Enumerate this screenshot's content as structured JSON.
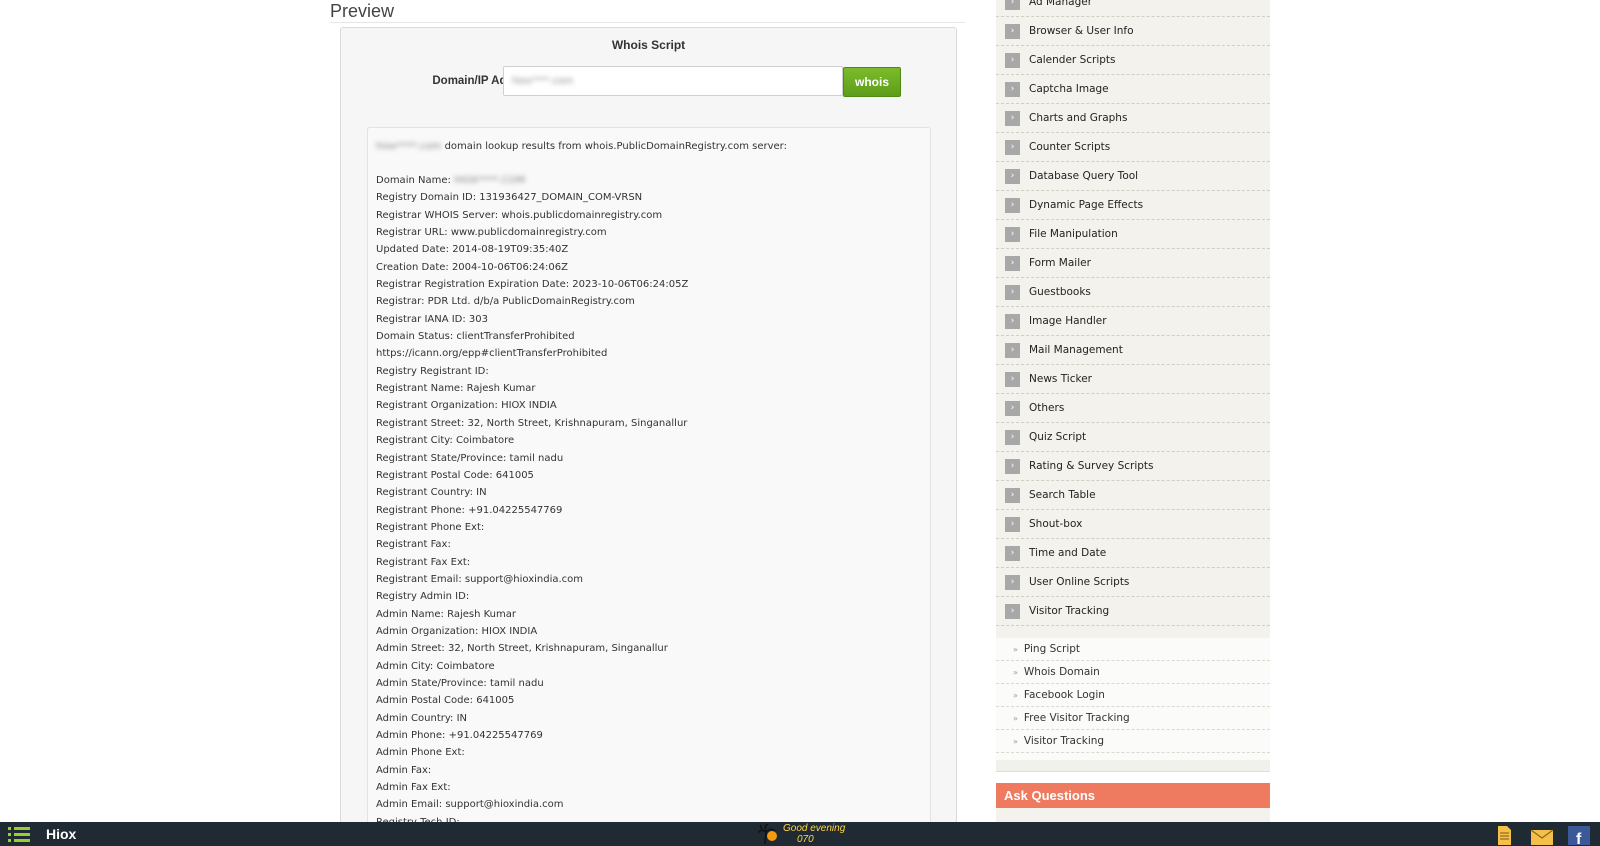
{
  "preview": {
    "title": "Preview"
  },
  "whois": {
    "title": "Whois Script",
    "domain_label": "Domain/IP Address:",
    "domain_value": "hiox****.com",
    "button_label": "whois",
    "results_intro_domain": "hiox****.com",
    "results_intro_rest": "domain lookup results from whois.PublicDomainRegistry.com server:",
    "domain_name_label": "Domain Name:",
    "domain_name_value": "HIOX****.COM",
    "lines": [
      "Registry Domain ID: 131936427_DOMAIN_COM-VRSN",
      "Registrar WHOIS Server: whois.publicdomainregistry.com",
      "Registrar URL: www.publicdomainregistry.com",
      "Updated Date: 2014-08-19T09:35:40Z",
      "Creation Date: 2004-10-06T06:24:06Z",
      "Registrar Registration Expiration Date: 2023-10-06T06:24:05Z",
      "Registrar: PDR Ltd. d/b/a PublicDomainRegistry.com",
      "Registrar IANA ID: 303",
      "Domain Status: clientTransferProhibited",
      "https://icann.org/epp#clientTransferProhibited",
      "Registry Registrant ID:",
      "Registrant Name: Rajesh Kumar",
      "Registrant Organization: HIOX INDIA",
      "Registrant Street: 32, North Street, Krishnapuram, Singanallur",
      "Registrant City: Coimbatore",
      "Registrant State/Province: tamil nadu",
      "Registrant Postal Code: 641005",
      "Registrant Country: IN",
      "Registrant Phone: +91.04225547769",
      "Registrant Phone Ext:",
      "Registrant Fax:",
      "Registrant Fax Ext:",
      "Registrant Email: support@hioxindia.com",
      "Registry Admin ID:",
      "Admin Name: Rajesh Kumar",
      "Admin Organization: HIOX INDIA",
      "Admin Street: 32, North Street, Krishnapuram, Singanallur",
      "Admin City: Coimbatore",
      "Admin State/Province: tamil nadu",
      "Admin Postal Code: 641005",
      "Admin Country: IN",
      "Admin Phone: +91.04225547769",
      "Admin Phone Ext:",
      "Admin Fax:",
      "Admin Fax Ext:",
      "Admin Email: support@hioxindia.com",
      "Registry Tech ID:"
    ]
  },
  "sidebar": {
    "items": [
      "Ad Manager",
      "Browser & User Info",
      "Calender Scripts",
      "Captcha Image",
      "Charts and Graphs",
      "Counter Scripts",
      "Database Query Tool",
      "Dynamic Page Effects",
      "File Manipulation",
      "Form Mailer",
      "Guestbooks",
      "Image Handler",
      "Mail Management",
      "News Ticker",
      "Others",
      "Quiz Script",
      "Rating & Survey Scripts",
      "Search Table",
      "Shout-box",
      "Time and Date",
      "User Online Scripts",
      "Visitor Tracking"
    ],
    "sub_items": [
      "Ping Script",
      "Whois Domain",
      "Facebook Login",
      "Free Visitor Tracking",
      "Visitor Tracking"
    ],
    "ask_questions": "Ask Questions"
  },
  "bottom_bar": {
    "brand": "Hiox",
    "greeting": "Good evening",
    "greeting_sub": "070"
  },
  "colors": {
    "whois_button": "#6aab20",
    "ask_bar": "#ee7a5f",
    "bottom_bar": "#1f2a33",
    "menu_icon": "#9acd32",
    "greeting": "#ffd54a"
  },
  "icons": {
    "sidebar_arrow": "chevron-right-icon",
    "sub_bullet": "bullet-icon",
    "menu": "hamburger-menu-icon",
    "greeting": "palm-tree-sun-icon",
    "document": "document-icon",
    "mail": "mail-icon",
    "facebook": "facebook-icon"
  }
}
